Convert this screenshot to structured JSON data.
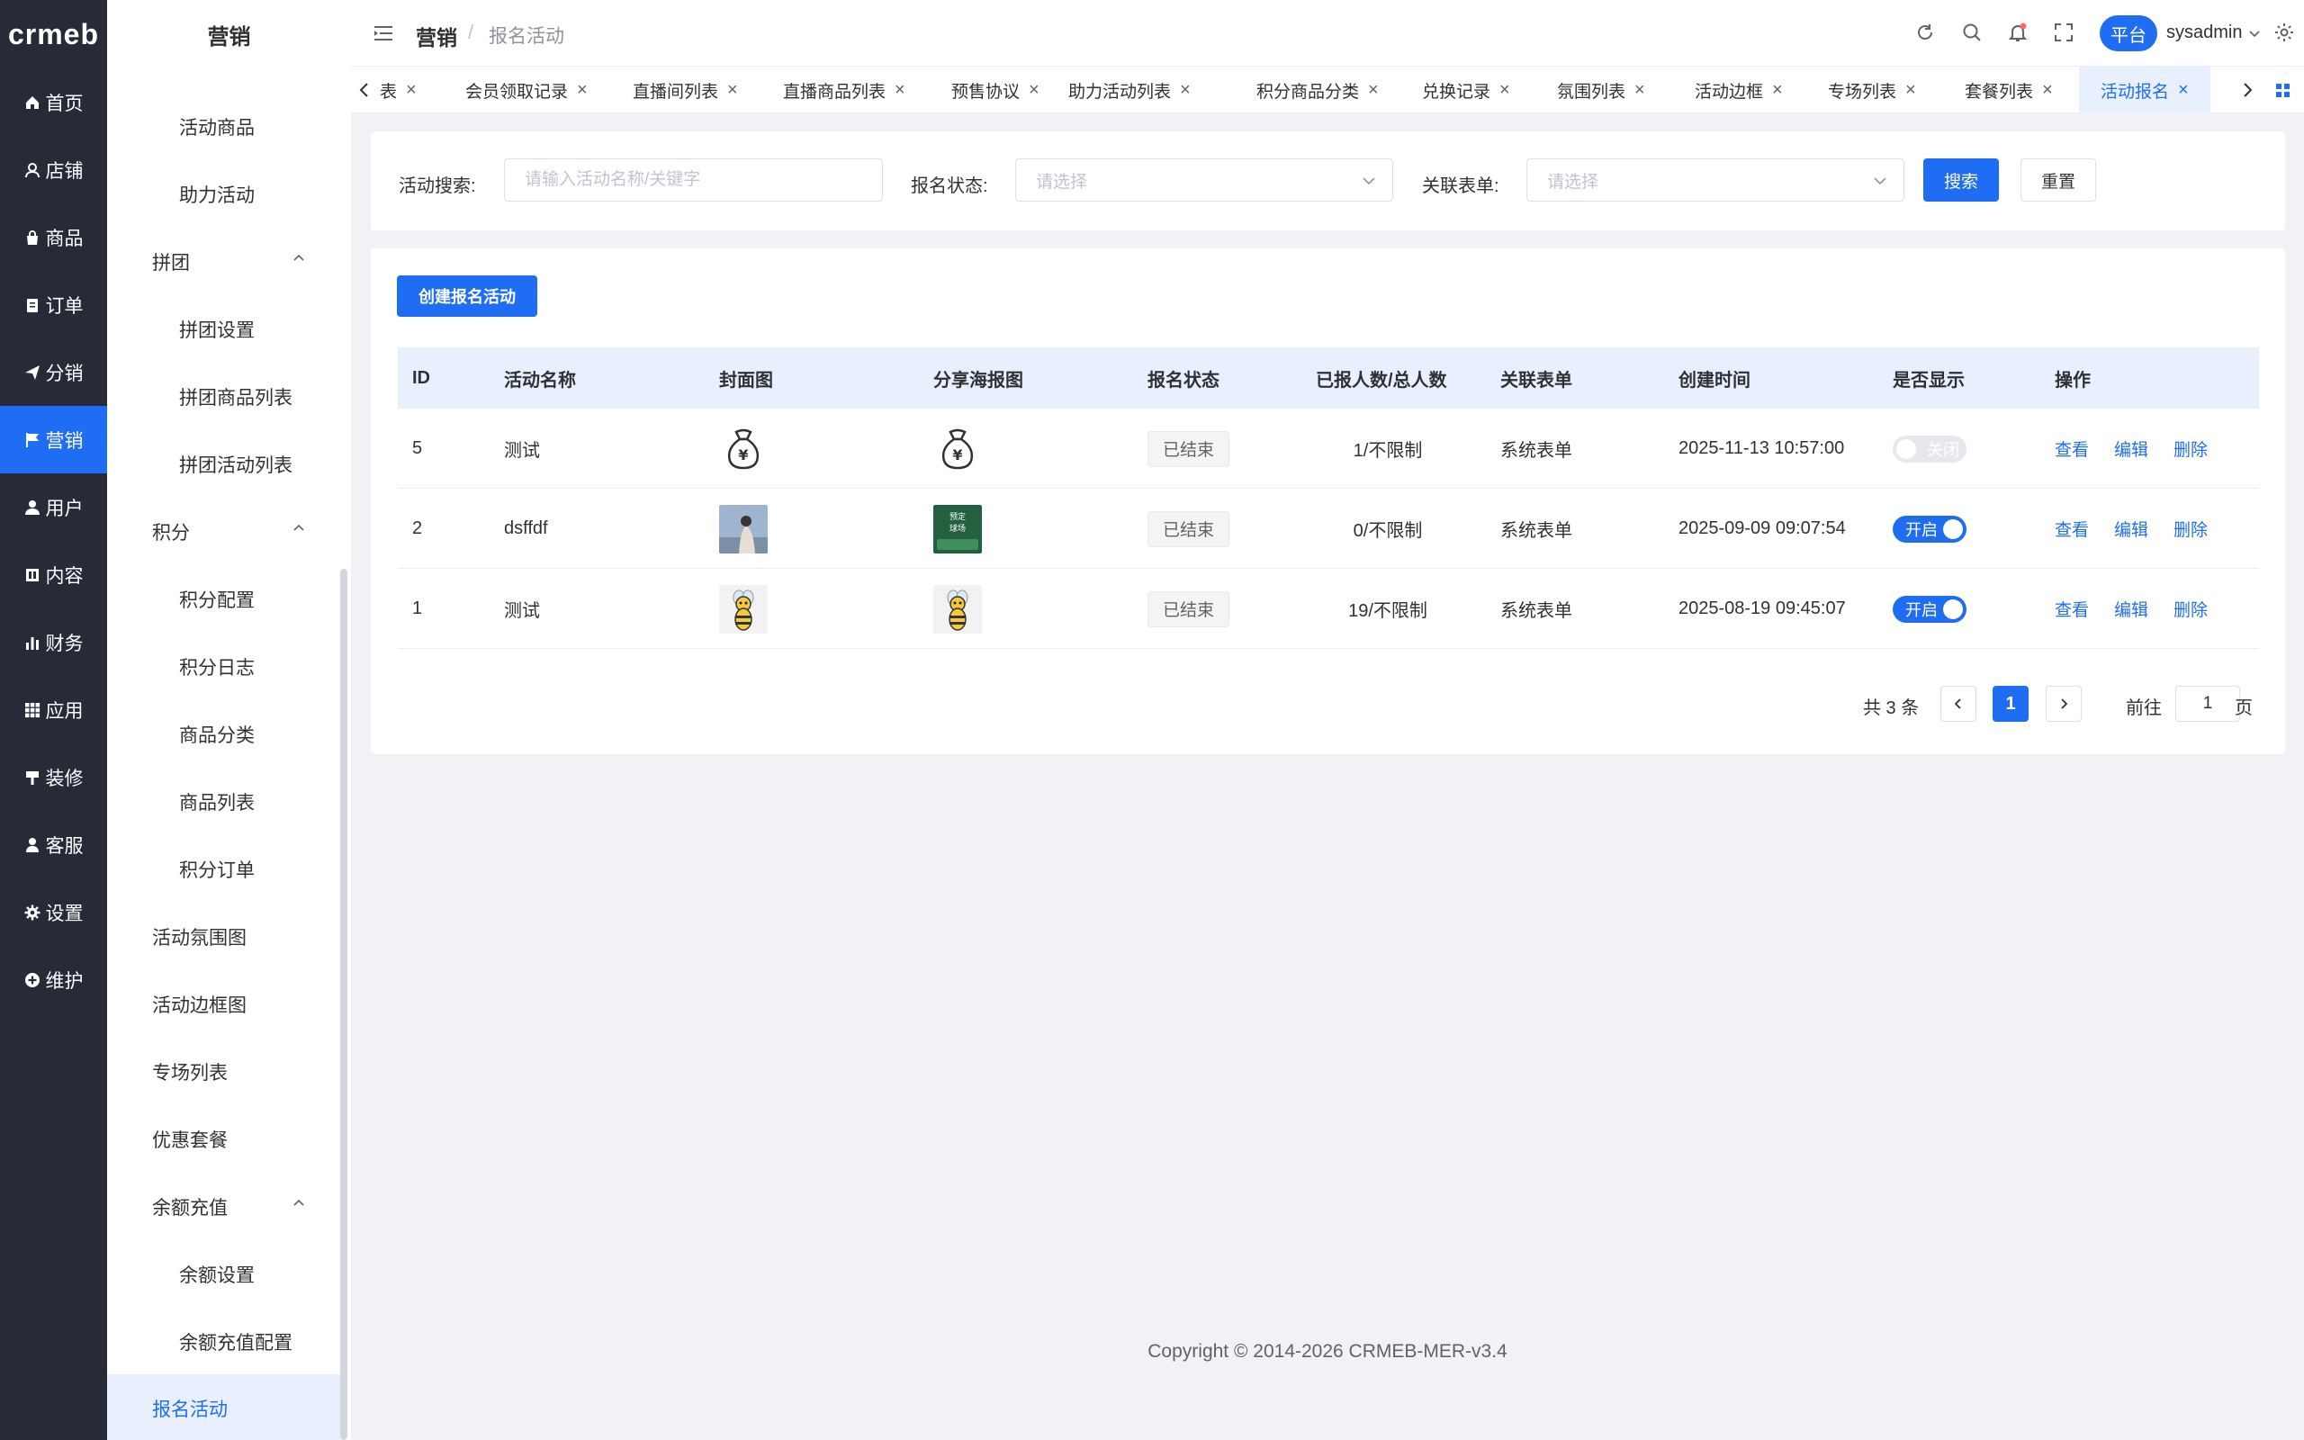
{
  "logo": "crmeb",
  "nav1": [
    {
      "label": "首页",
      "icon": "home-icon"
    },
    {
      "label": "店铺",
      "icon": "store-icon"
    },
    {
      "label": "商品",
      "icon": "product-icon"
    },
    {
      "label": "订单",
      "icon": "order-icon"
    },
    {
      "label": "分销",
      "icon": "send-icon"
    },
    {
      "label": "营销",
      "icon": "flag-icon"
    },
    {
      "label": "用户",
      "icon": "user-icon"
    },
    {
      "label": "内容",
      "icon": "content-icon"
    },
    {
      "label": "财务",
      "icon": "chart-icon"
    },
    {
      "label": "应用",
      "icon": "grid-icon"
    },
    {
      "label": "装修",
      "icon": "brush-icon"
    },
    {
      "label": "客服",
      "icon": "service-icon"
    },
    {
      "label": "设置",
      "icon": "gear-icon"
    },
    {
      "label": "维护",
      "icon": "plus-circle-icon"
    }
  ],
  "nav2": {
    "title": "营销",
    "items": [
      {
        "label": "活动商品"
      },
      {
        "label": "助力活动"
      },
      {
        "label": "拼团"
      },
      {
        "label": "拼团设置"
      },
      {
        "label": "拼团商品列表"
      },
      {
        "label": "拼团活动列表"
      },
      {
        "label": "积分"
      },
      {
        "label": "积分配置"
      },
      {
        "label": "积分日志"
      },
      {
        "label": "商品分类"
      },
      {
        "label": "商品列表"
      },
      {
        "label": "积分订单"
      },
      {
        "label": "活动氛围图"
      },
      {
        "label": "活动边框图"
      },
      {
        "label": "专场列表"
      },
      {
        "label": "优惠套餐"
      },
      {
        "label": "余额充值"
      },
      {
        "label": "余额设置"
      },
      {
        "label": "余额充值配置"
      },
      {
        "label": "报名活动"
      }
    ]
  },
  "header": {
    "breadcrumb_main": "营销",
    "breadcrumb_sep": "/",
    "breadcrumb_sub": "报名活动",
    "platform_label": "平台",
    "username": "sysadmin"
  },
  "tabs": [
    {
      "label": "表"
    },
    {
      "label": "会员领取记录"
    },
    {
      "label": "直播间列表"
    },
    {
      "label": "直播商品列表"
    },
    {
      "label": "预售协议"
    },
    {
      "label": "助力活动列表"
    },
    {
      "label": "积分商品分类"
    },
    {
      "label": "兑换记录"
    },
    {
      "label": "氛围列表"
    },
    {
      "label": "活动边框"
    },
    {
      "label": "专场列表"
    },
    {
      "label": "套餐列表"
    },
    {
      "label": "活动报名"
    }
  ],
  "tab_close": "×",
  "search": {
    "keyword_label": "活动搜索:",
    "keyword_placeholder": "请输入活动名称/关键字",
    "status_label": "报名状态:",
    "status_placeholder": "请选择",
    "form_label": "关联表单:",
    "form_placeholder": "请选择",
    "search_button": "搜索",
    "reset_button": "重置"
  },
  "create_button": "创建报名活动",
  "table": {
    "headers": [
      "ID",
      "活动名称",
      "封面图",
      "分享海报图",
      "报名状态",
      "已报人数/总人数",
      "关联表单",
      "创建时间",
      "是否显示",
      "操作"
    ],
    "rows": [
      {
        "id": "5",
        "name": "测试",
        "cover": "money-bag-icon",
        "poster": "money-bag-icon",
        "status": "已结束",
        "count": "1/不限制",
        "form": "系统表单",
        "created": "2025-11-13 10:57:00",
        "show": false,
        "show_label": "关闭"
      },
      {
        "id": "2",
        "name": "dsffdf",
        "cover": "photo-thumbnail",
        "poster": "green-poster-thumbnail",
        "poster_text": "预定 球场",
        "status": "已结束",
        "count": "0/不限制",
        "form": "系统表单",
        "created": "2025-09-09 09:07:54",
        "show": true,
        "show_label": "开启"
      },
      {
        "id": "1",
        "name": "测试",
        "cover": "bee-mascot-icon",
        "poster": "bee-mascot-icon",
        "status": "已结束",
        "count": "19/不限制",
        "form": "系统表单",
        "created": "2025-08-19 09:45:07",
        "show": true,
        "show_label": "开启"
      }
    ],
    "actions": [
      "查看",
      "编辑",
      "删除"
    ]
  },
  "pagination": {
    "total_text": "共 3 条",
    "current_page": "1",
    "goto_label": "前往",
    "goto_value": "1",
    "page_suffix": "页"
  },
  "footer": "Copyright © 2014-2026 CRMEB-MER-v3.4",
  "colors": {
    "primary": "#1f6df2",
    "sidebar_dark": "#262b37",
    "header_bg": "#e8f0ff"
  }
}
